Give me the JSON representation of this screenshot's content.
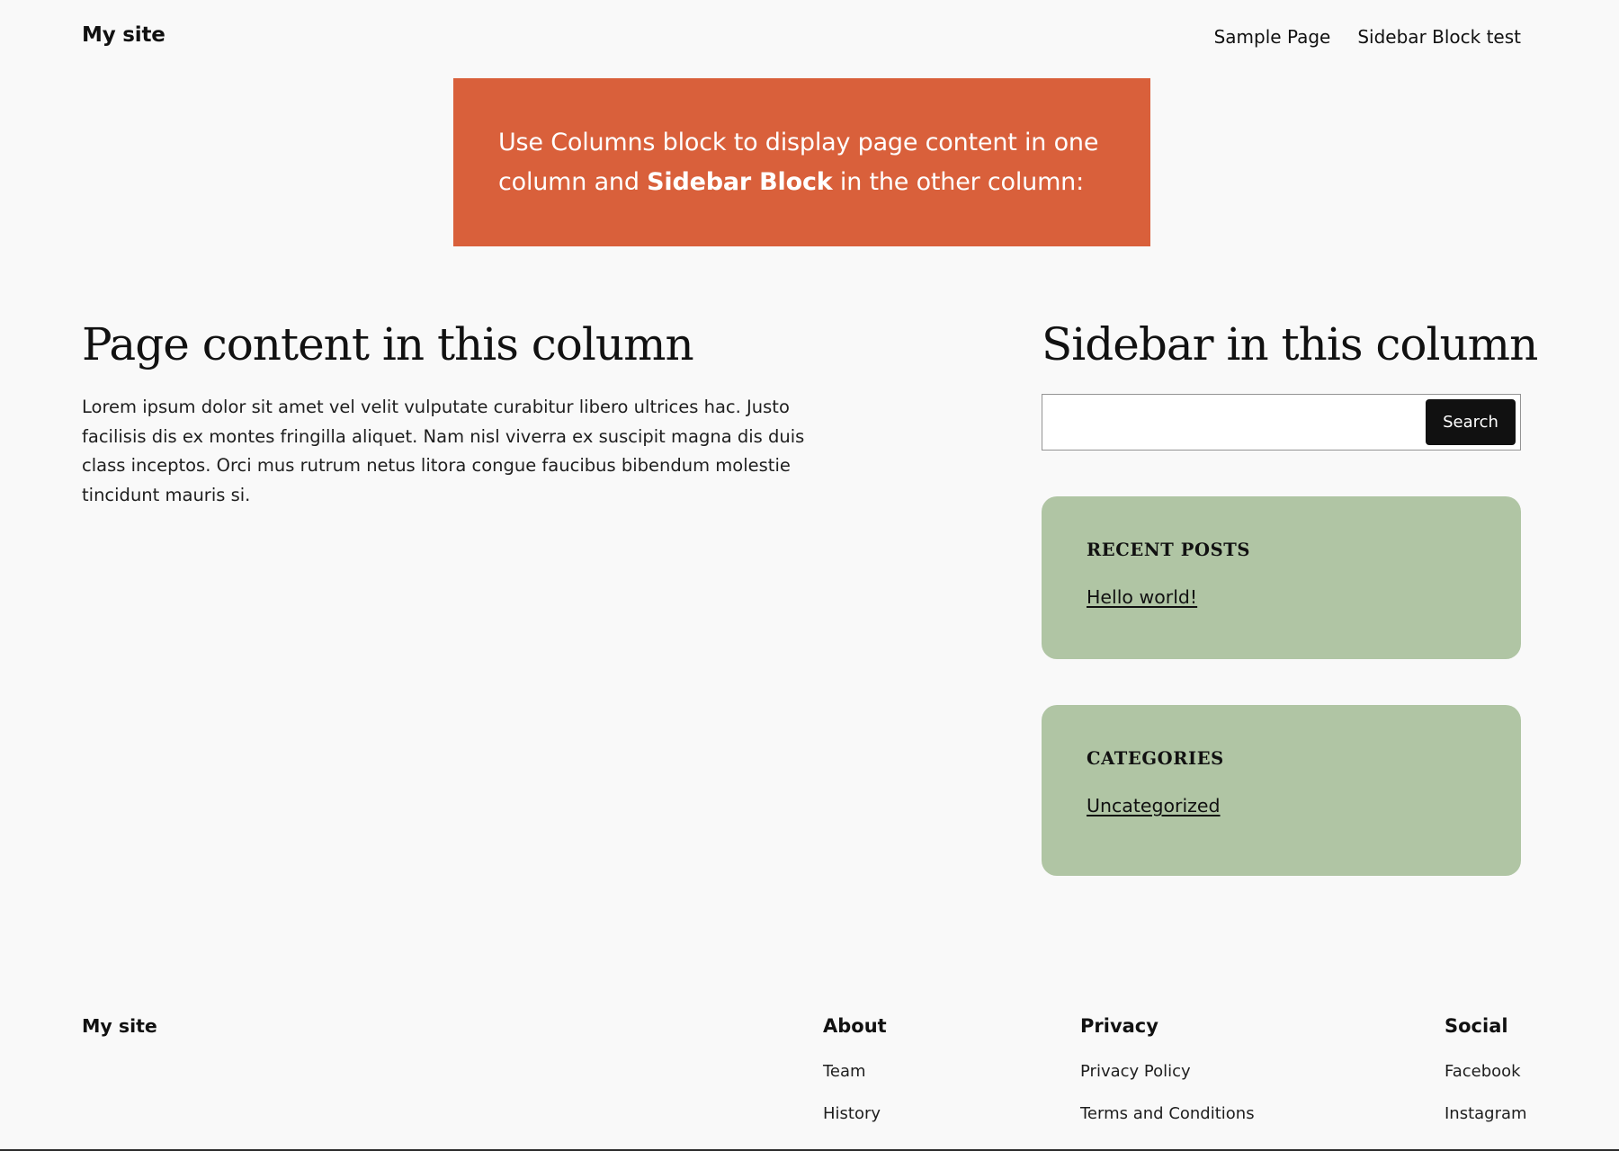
{
  "header": {
    "site_title": "My site",
    "nav": [
      "Sample Page",
      "Sidebar Block test"
    ]
  },
  "banner": {
    "text_before": "Use Columns block to display page content in one column and ",
    "text_bold": "Sidebar Block",
    "text_after": " in the other column:",
    "background_color": "#d9603b"
  },
  "main": {
    "heading": "Page content in this column",
    "body": "Lorem ipsum dolor sit amet vel velit vulputate curabitur libero ultrices hac. Justo facilisis dis ex montes fringilla aliquet. Nam nisl viverra ex suscipit magna dis duis class inceptos. Orci mus rutrum netus litora congue faucibus bibendum molestie tincidunt mauris si."
  },
  "sidebar": {
    "heading": "Sidebar in this column",
    "search": {
      "value": "",
      "placeholder": "",
      "button_label": "Search"
    },
    "widgets": [
      {
        "title": "Recent Posts",
        "link": "Hello world!"
      },
      {
        "title": "Categories",
        "link": "Uncategorized"
      }
    ],
    "widget_color": "#b0c5a4"
  },
  "footer": {
    "site_title": "My site",
    "columns": [
      {
        "heading": "About",
        "links": [
          "Team",
          "History"
        ]
      },
      {
        "heading": "Privacy",
        "links": [
          "Privacy Policy",
          "Terms and Conditions"
        ]
      },
      {
        "heading": "Social",
        "links": [
          "Facebook",
          "Instagram"
        ]
      }
    ]
  }
}
